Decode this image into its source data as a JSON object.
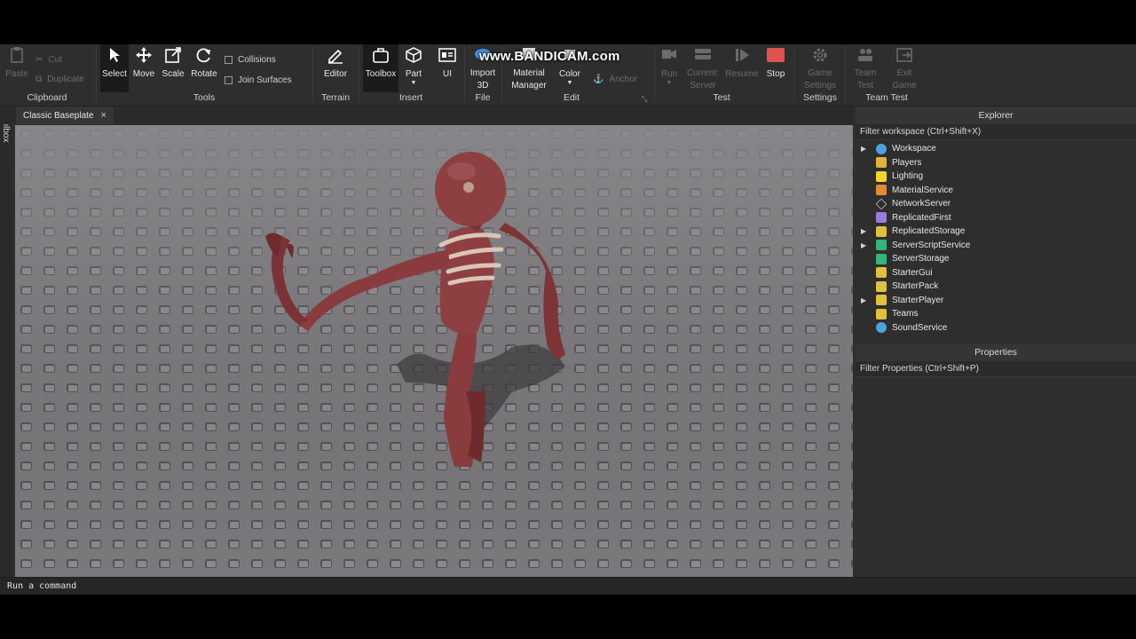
{
  "watermark": "www.BANDICAM.com",
  "ribbon": {
    "clipboard": {
      "paste": "Paste",
      "cut": "Cut",
      "duplicate": "Duplicate",
      "group": "Clipboard"
    },
    "tools": {
      "select": "Select",
      "move": "Move",
      "scale": "Scale",
      "rotate": "Rotate",
      "collisions": "Collisions",
      "join_surfaces": "Join Surfaces",
      "group": "Tools"
    },
    "terrain": {
      "editor": "Editor",
      "group": "Terrain"
    },
    "insert": {
      "toolbox": "Toolbox",
      "part": "Part",
      "ui": "UI",
      "group": "Insert"
    },
    "file": {
      "import": "Import\n3D",
      "group": "File"
    },
    "edit": {
      "material": "Material\nManager",
      "color": "Color",
      "anchor": "Anchor",
      "group": "Edit"
    },
    "test": {
      "run": "Run",
      "current": "Current:\nServer",
      "resume": "Resume",
      "stop": "Stop",
      "group": "Test"
    },
    "settings": {
      "game_settings": "Game\nSettings",
      "group": "Settings"
    },
    "team_test": {
      "team_test": "Team\nTest",
      "exit_game": "Exit\nGame",
      "group": "Team Test"
    }
  },
  "side_toolbox": "Toolbox",
  "tab": {
    "label": "Classic Baseplate",
    "close": "×"
  },
  "explorer": {
    "title": "Explorer",
    "filter": "Filter workspace (Ctrl+Shift+X)",
    "items": [
      {
        "label": "Workspace",
        "icon": "workspace-icon",
        "color": "#4aa3df",
        "expandable": true
      },
      {
        "label": "Players",
        "icon": "players-icon",
        "color": "#e0b43c",
        "expandable": false
      },
      {
        "label": "Lighting",
        "icon": "lighting-icon",
        "color": "#f2d32b",
        "expandable": false
      },
      {
        "label": "MaterialService",
        "icon": "material-service-icon",
        "color": "#e08a3c",
        "expandable": false
      },
      {
        "label": "NetworkServer",
        "icon": "network-server-icon",
        "color": "#cfcfcf",
        "expandable": false
      },
      {
        "label": "ReplicatedFirst",
        "icon": "replicated-first-icon",
        "color": "#9a7be0",
        "expandable": false
      },
      {
        "label": "ReplicatedStorage",
        "icon": "replicated-storage-icon",
        "color": "#e0c03c",
        "expandable": true
      },
      {
        "label": "ServerScriptService",
        "icon": "server-script-service-icon",
        "color": "#2fb67a",
        "expandable": true
      },
      {
        "label": "ServerStorage",
        "icon": "server-storage-icon",
        "color": "#2fb67a",
        "expandable": false
      },
      {
        "label": "StarterGui",
        "icon": "starter-gui-icon",
        "color": "#e0c03c",
        "expandable": false
      },
      {
        "label": "StarterPack",
        "icon": "starter-pack-icon",
        "color": "#e0c03c",
        "expandable": false
      },
      {
        "label": "StarterPlayer",
        "icon": "starter-player-icon",
        "color": "#e0c03c",
        "expandable": true
      },
      {
        "label": "Teams",
        "icon": "teams-icon",
        "color": "#e0c03c",
        "expandable": false
      },
      {
        "label": "SoundService",
        "icon": "sound-service-icon",
        "color": "#4aa3df",
        "expandable": false
      }
    ]
  },
  "properties": {
    "title": "Properties",
    "filter": "Filter Properties (Ctrl+Shift+P)"
  },
  "command_bar": {
    "placeholder": "Run a command"
  },
  "colors": {
    "stop": "#e05252",
    "background": "#2e2e2e",
    "baseplate": "#7d7b7e"
  }
}
